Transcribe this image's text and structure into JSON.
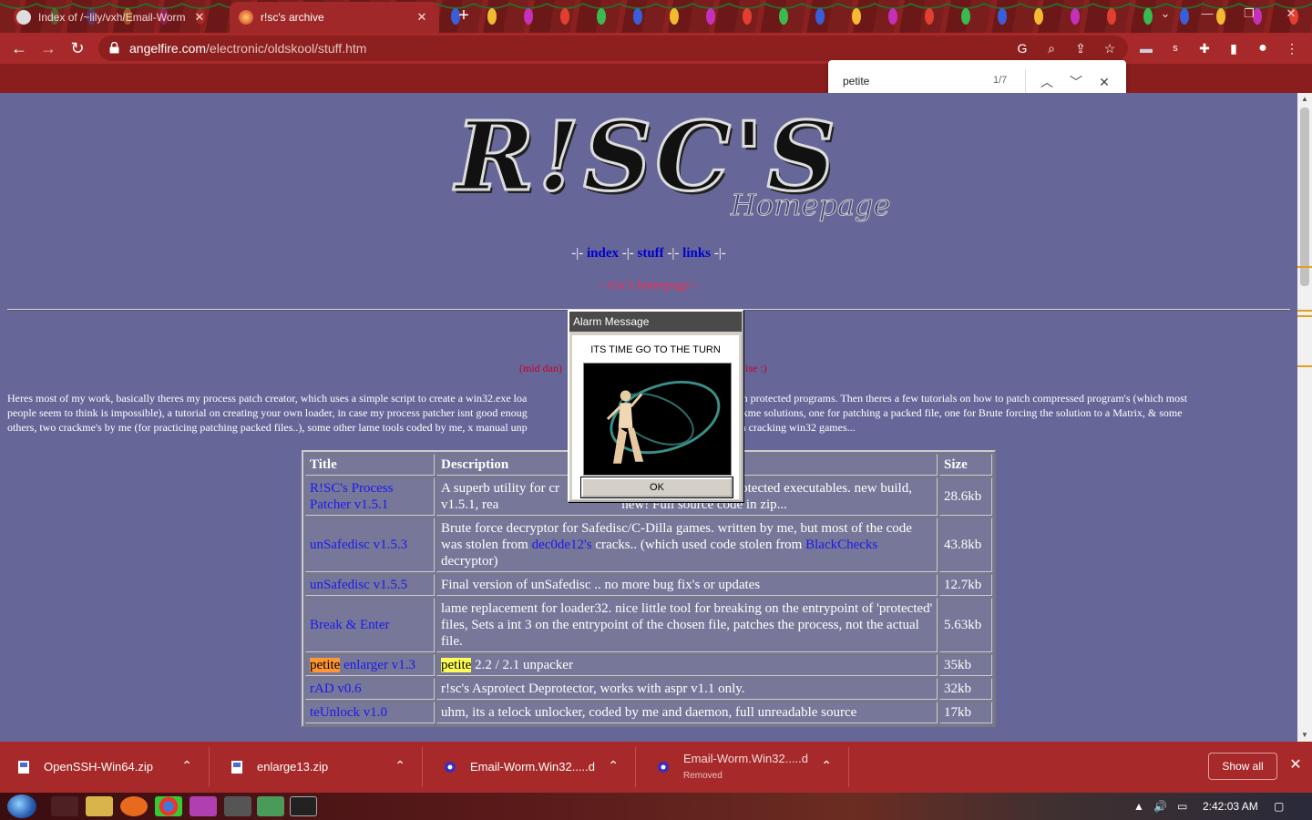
{
  "browser": {
    "tabs": [
      {
        "title": "Index of /~lily/vxh/Email-Worm",
        "active": false
      },
      {
        "title": "r!sc's archive",
        "active": true
      }
    ],
    "url_domain": "angelfire.com",
    "url_path": "/electronic/oldskool/stuff.htm",
    "find": {
      "query": "petite",
      "count": "1/7"
    },
    "colors": {
      "chrome": "#a82929",
      "tabbar": "#7a1d1d",
      "page_bg": "#666699"
    }
  },
  "page": {
    "logo_main": "R!SC'S",
    "logo_sub": "Homepage",
    "nav": {
      "sep": "-|-",
      "items": [
        "index",
        "stuff",
        "links"
      ]
    },
    "homepage_link": "r!sc's homepage",
    "redline_left": "(mid dan)",
    "redline_right": "ise :)",
    "intro_line1": "Heres most of my work, basically theres my process patch creator, which uses a simple script to create a win32.exe loa",
    "intro_line1b": "y to patch protected programs. Then theres a few tutorials on how to patch compressed program's (which most",
    "intro_line2": "people seem to think is impossible), a tutorial on creating your own loader, in case my process patcher isnt good enoug",
    "intro_line2b": "few crackme solutions, one for patching a packed file, one for Brute forcing the solution to a Matrix, & some",
    "intro_line3": "others, two crackme's by me (for practicing patching packed files..), some other lame tools coded by me, x manual unp",
    "intro_line3b": "torials on cracking win32 games...",
    "table": {
      "headers": [
        "Title",
        "Description",
        "Size"
      ],
      "rows": [
        {
          "title": "R!SC's Process Patcher v1.5.1",
          "desc": "A superb utility for cr                                    mory of protected executables. new build, v1.5.1, rea                                    new! Full source code in zip...",
          "size": "28.6kb"
        },
        {
          "title": "unSafedisc v1.5.3",
          "desc_a": "Brute force decryptor for Safedisc/C-Dilla games. written by me, but most of the code was stolen from ",
          "link1": "dec0de12's",
          "desc_b": " cracks.. (which used code stolen from ",
          "link2": "BlackChecks",
          "desc_c": " decryptor)",
          "size": "43.8kb"
        },
        {
          "title": "unSafedisc v1.5.5",
          "desc": "Final version of unSafedisc .. no more bug fix's or updates",
          "size": "12.7kb"
        },
        {
          "title": "Break & Enter",
          "desc": "lame replacement for loader32. nice little tool for breaking on the entrypoint of 'protected' files, Sets a int 3 on the entrypoint of the chosen file, patches the process, not the actual file.",
          "size": "5.63kb"
        },
        {
          "title_hl": "petite",
          "title_rest": " enlarger v1.3",
          "desc_hl": "petite",
          "desc_rest": " 2.2 / 2.1 unpacker",
          "size": "35kb"
        },
        {
          "title": "rAD v0.6",
          "desc": "r!sc's Asprotect Deprotector, works with aspr v1.1 only.",
          "size": "32kb"
        },
        {
          "title": "teUnlock v1.0",
          "desc": "uhm, its a telock unlocker, coded by me and daemon, full unreadable source",
          "size": "17kb"
        }
      ]
    }
  },
  "dialog": {
    "title": "Alarm Message",
    "message": "ITS TIME GO TO THE TURN",
    "ok": "OK"
  },
  "downloads": {
    "items": [
      {
        "name": "OpenSSH-Win64.zip",
        "status": ""
      },
      {
        "name": "enlarge13.zip",
        "status": ""
      },
      {
        "name": "Email-Worm.Win32.....d",
        "status": ""
      },
      {
        "name": "Email-Worm.Win32.....d",
        "status": "Removed"
      }
    ],
    "show_all": "Show all"
  },
  "taskbar": {
    "time": "2:42:03 AM"
  }
}
